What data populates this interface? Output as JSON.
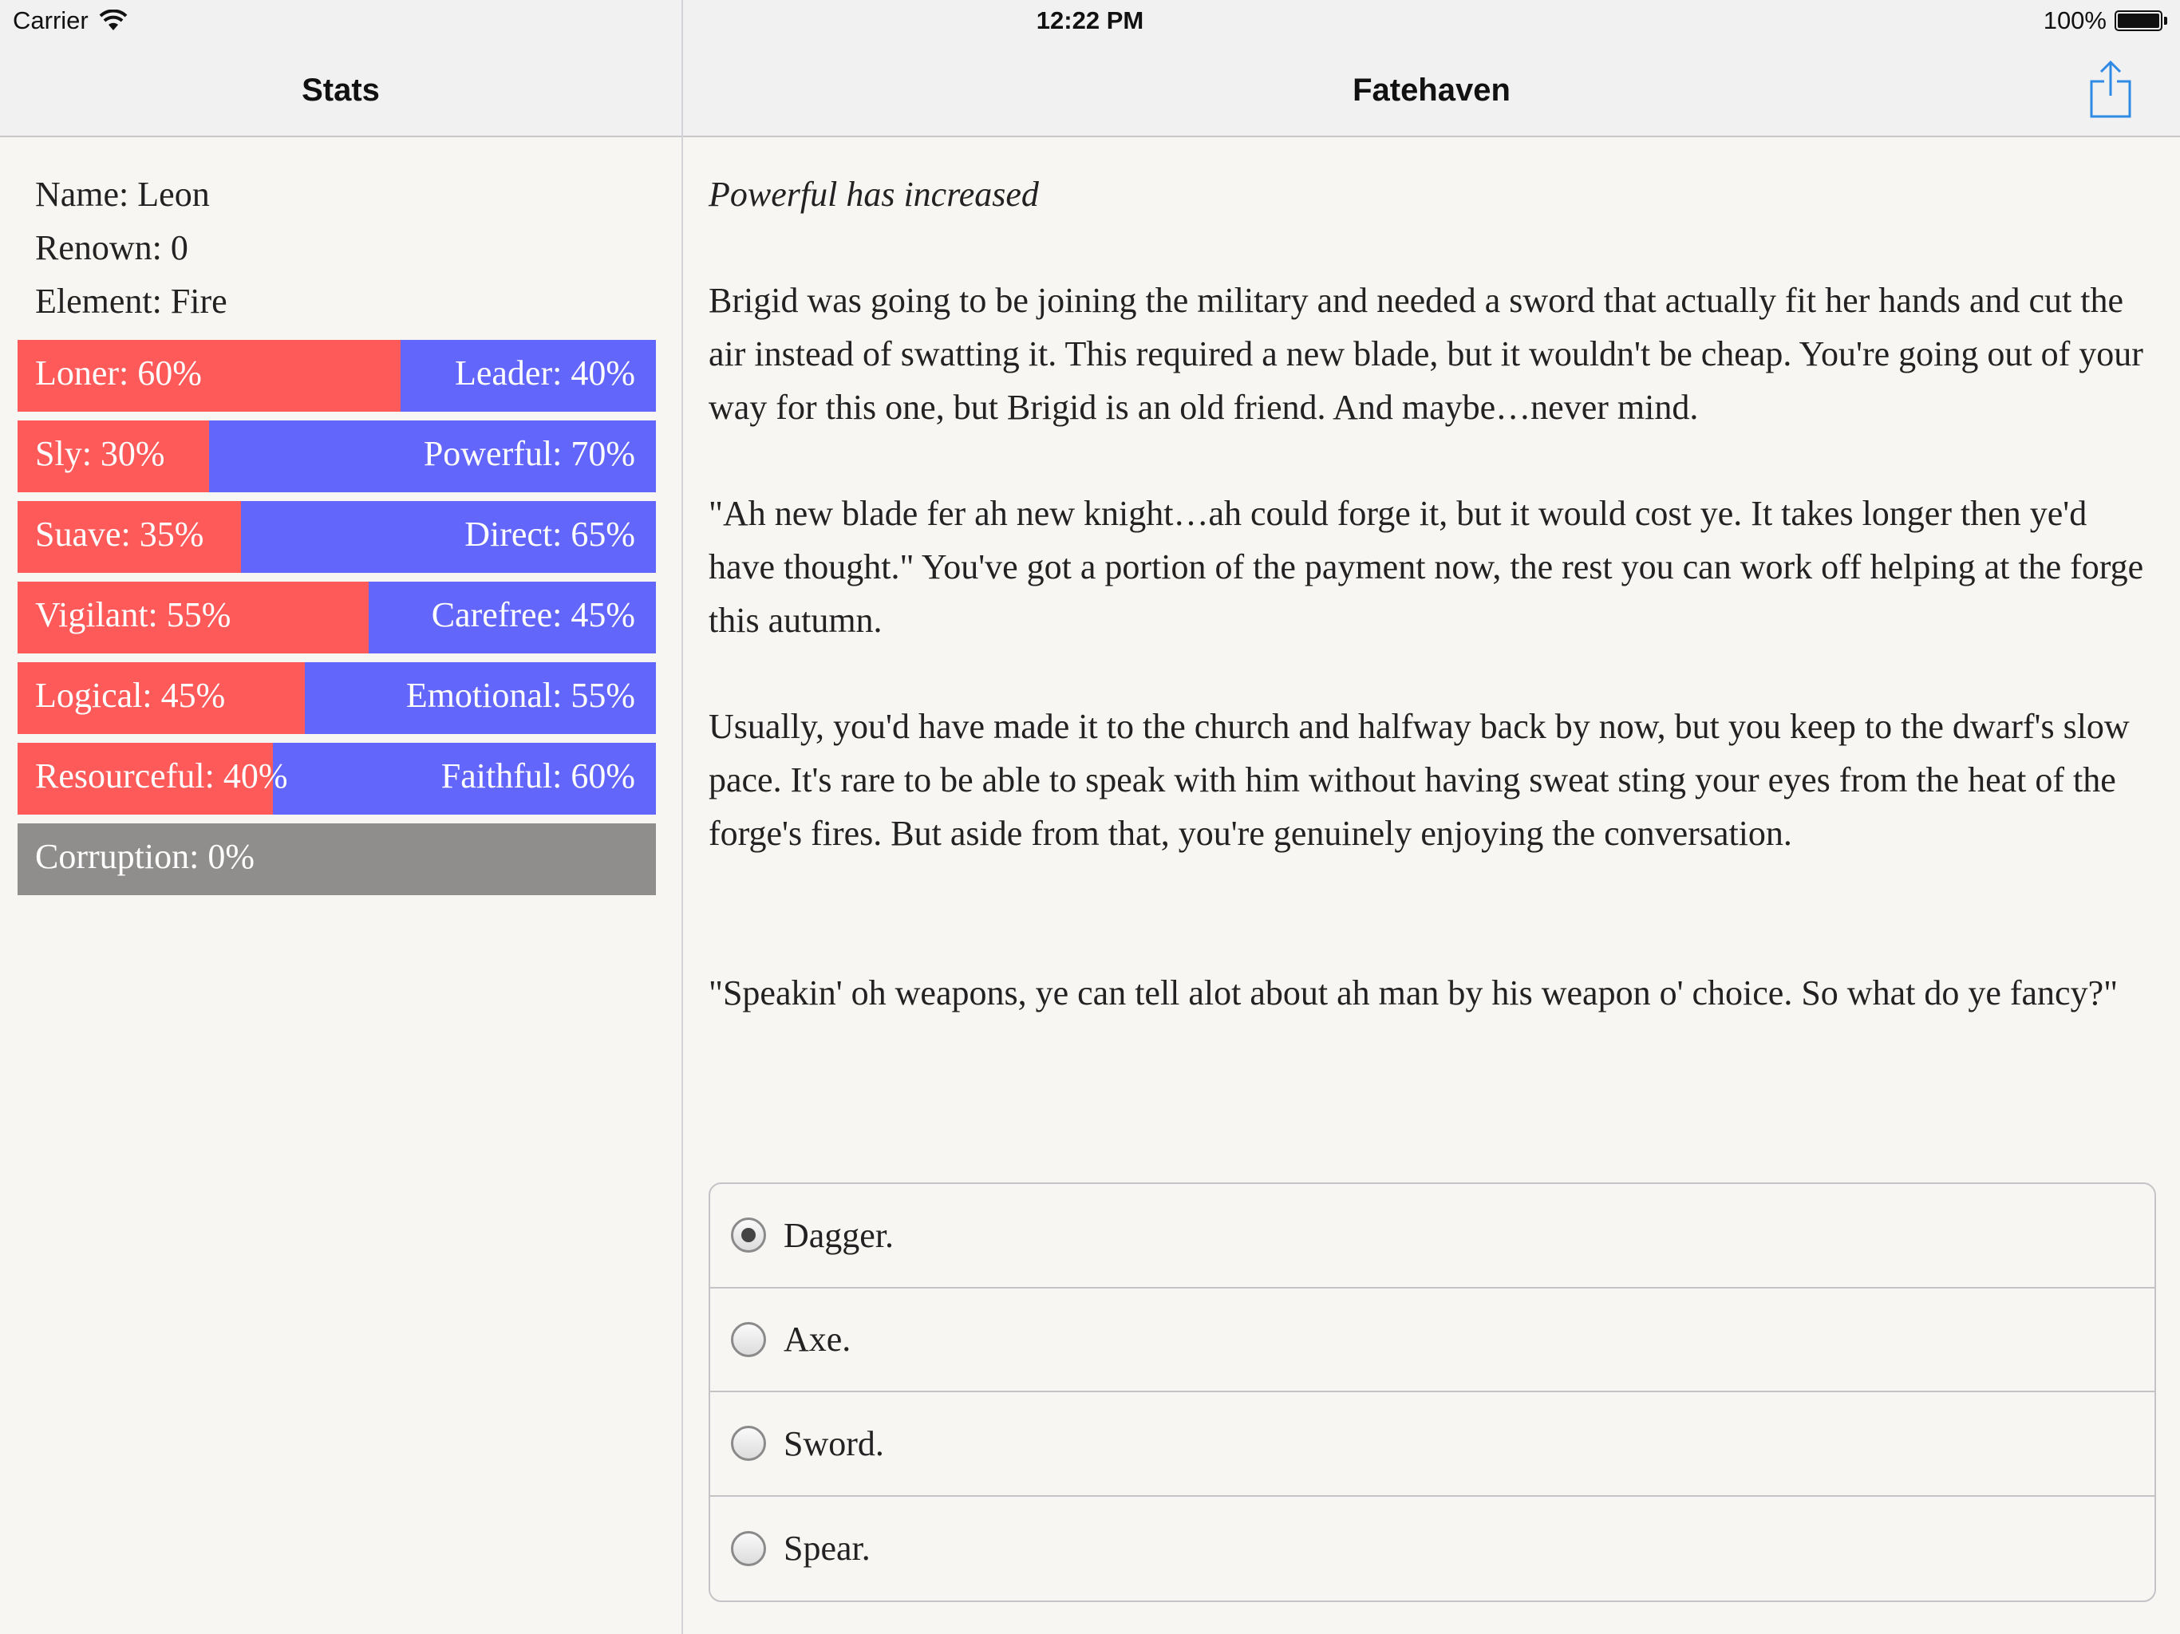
{
  "status_bar": {
    "carrier": "Carrier",
    "time": "12:22 PM",
    "battery": "100%"
  },
  "nav": {
    "left_title": "Stats",
    "right_title": "Fatehaven",
    "share_icon": "share-icon"
  },
  "stats": {
    "name": "Name: Leon",
    "renown": "Renown: 0",
    "element": "Element: Fire",
    "bars": [
      {
        "left_label": "Loner: 60%",
        "right_label": "Leader: 40%",
        "left_fraction": 0.6
      },
      {
        "left_label": "Sly: 30%",
        "right_label": "Powerful: 70%",
        "left_fraction": 0.3
      },
      {
        "left_label": "Suave: 35%",
        "right_label": "Direct: 65%",
        "left_fraction": 0.35
      },
      {
        "left_label": "Vigilant: 55%",
        "right_label": "Carefree: 45%",
        "left_fraction": 0.55
      },
      {
        "left_label": "Logical: 45%",
        "right_label": "Emotional: 55%",
        "left_fraction": 0.45
      },
      {
        "left_label": "Resourceful: 40%",
        "right_label": "Faithful: 60%",
        "left_fraction": 0.4
      }
    ],
    "corruption": "Corruption: 0%",
    "colors": {
      "left": "#fe5a5a",
      "right": "#6366fb",
      "corruption": "#8f8e8d"
    }
  },
  "story": {
    "notice": "Powerful has increased",
    "paragraphs": [
      "Brigid was going to be joining the military and needed a sword that actually fit her hands and cut the air instead of swatting it. This required a new blade, but it wouldn't be cheap. You're going out of your way for this one, but Brigid is an old friend. And maybe…never mind.",
      "\"Ah new blade fer ah new knight…ah could forge it, but it would cost ye. It takes longer then ye'd have thought.\" You've got a portion of the payment now, the rest you can work off helping at the forge this autumn.",
      "Usually, you'd have made it to the church and halfway back by now, but you keep to the dwarf's slow pace. It's rare to be able to speak with him without having sweat sting your eyes from the heat of the forge's fires. But aside from that, you're genuinely enjoying the conversation.",
      "\"Speakin' oh weapons, ye can tell alot about ah man by his weapon o' choice. So what do ye fancy?\""
    ]
  },
  "choices": [
    {
      "label": "Dagger.",
      "selected": true
    },
    {
      "label": "Axe.",
      "selected": false
    },
    {
      "label": "Sword.",
      "selected": false
    },
    {
      "label": "Spear.",
      "selected": false
    }
  ]
}
